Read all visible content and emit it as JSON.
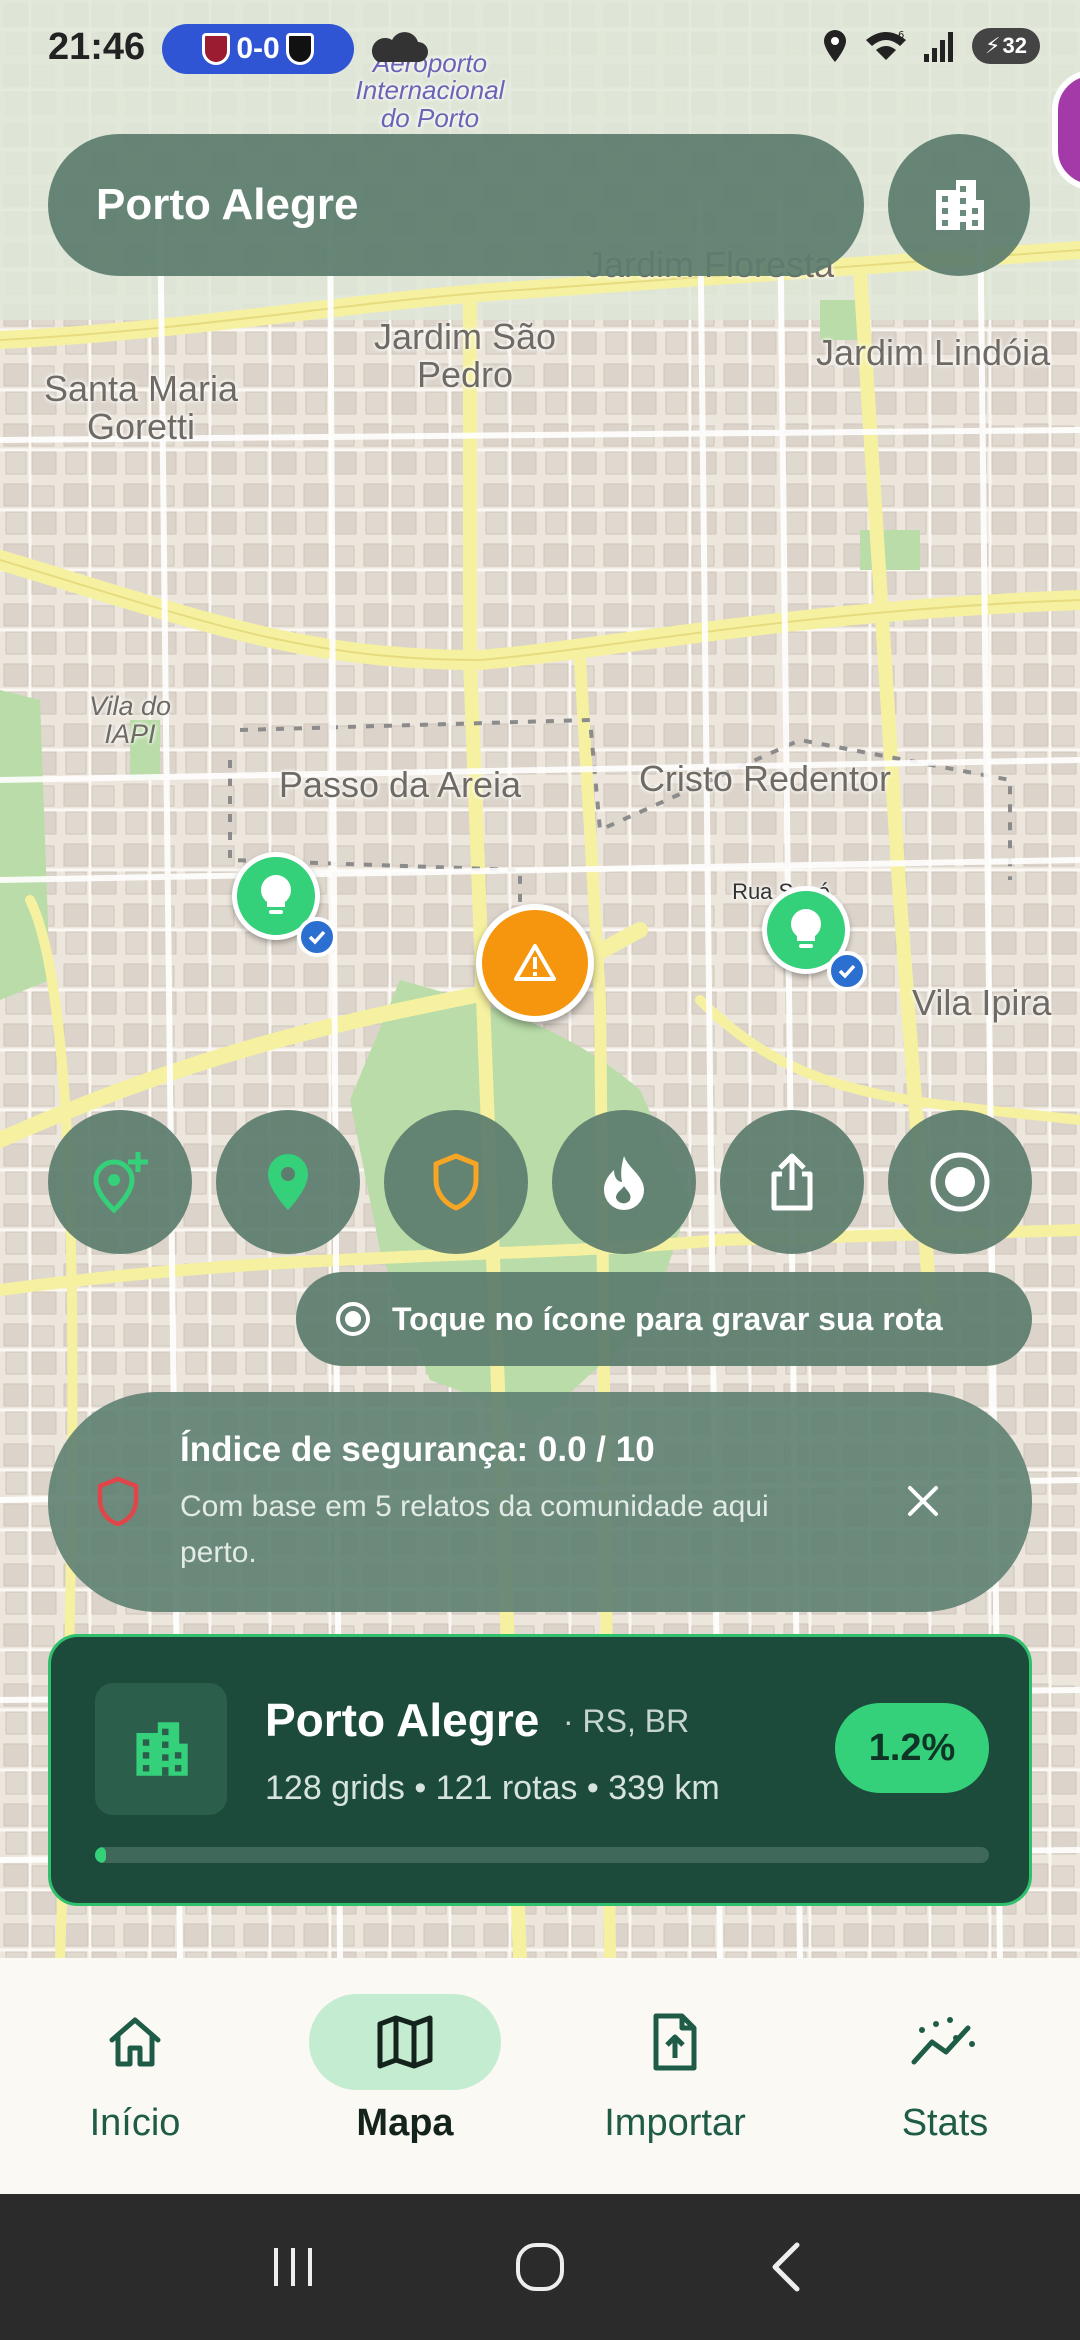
{
  "status_bar": {
    "time": "21:46",
    "score": "0-0",
    "battery": "32",
    "wifi_badge": "6"
  },
  "map": {
    "labels": {
      "airport": "Aeroporto Internacional do Porto",
      "jardim_floresta": "Jardim Floresta",
      "jardim_sao_pedro": "Jardim São Pedro",
      "jardim_lindoia": "Jardim Lindóia",
      "santa_maria_goretti": "Santa Maria Goretti",
      "vila_iapi": "Vila do IAPI",
      "passo_da_areia": "Passo da Areia",
      "cristo_redentor": "Cristo Redentor",
      "vila_ipiranga": "Vila Ipira",
      "rua": "Rua Sapé"
    }
  },
  "search": {
    "city": "Porto Alegre",
    "city_button_icon": "city-icon"
  },
  "markers": {
    "alert_icon": "warning-icon",
    "report_icon": "lightbulb-icon"
  },
  "actions": [
    {
      "name": "add-location-button",
      "icon": "add-location-icon"
    },
    {
      "name": "location-pin-button",
      "icon": "location-pin-icon"
    },
    {
      "name": "shield-button",
      "icon": "shield-icon"
    },
    {
      "name": "heatmap-button",
      "icon": "fire-icon"
    },
    {
      "name": "share-button",
      "icon": "share-icon"
    },
    {
      "name": "record-button",
      "icon": "record-icon"
    }
  ],
  "record_hint": "Toque no ícone para gravar sua rota",
  "safety": {
    "title": "Índice de segurança: 0.0 / 10",
    "description": "Com base em 5 relatos da comunidade aqui perto."
  },
  "city_card": {
    "name": "Porto Alegre",
    "region": "· RS, BR",
    "stats": "128 grids • 121 rotas • 339 km",
    "percent": "1.2%",
    "progress": 0.012
  },
  "nav": {
    "items": [
      {
        "label": "Início",
        "icon": "home-icon"
      },
      {
        "label": "Mapa",
        "icon": "map-icon",
        "active": true
      },
      {
        "label": "Importar",
        "icon": "import-icon"
      },
      {
        "label": "Stats",
        "icon": "stats-icon"
      }
    ]
  },
  "colors": {
    "accent": "#34d07a",
    "card_bg": "#1d4b3b",
    "overlay": "#5c7d6e",
    "alert": "#f6960e",
    "danger": "#e0454a"
  }
}
